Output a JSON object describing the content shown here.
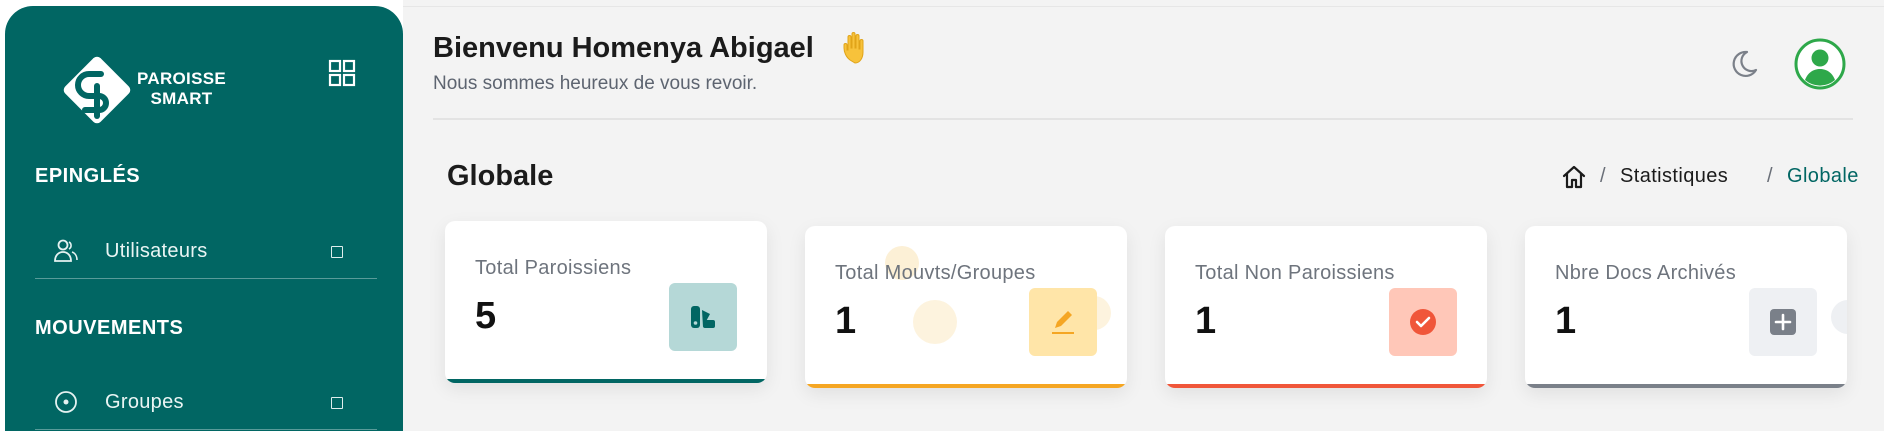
{
  "brand": {
    "line1": "PAROISSE",
    "line2": "SMART"
  },
  "sidebar": {
    "sections": [
      {
        "title": "EPINGLÉS",
        "items": [
          {
            "label": "Utilisateurs",
            "icon": "users-icon"
          }
        ]
      },
      {
        "title": "MOUVEMENTS",
        "items": [
          {
            "label": "Groupes",
            "icon": "circle-dot-icon"
          }
        ]
      }
    ]
  },
  "header": {
    "greeting": "Bienvenu Homenya Abigael",
    "subtitle": "Nous sommes heureux de vous revoir."
  },
  "page": {
    "title": "Globale",
    "breadcrumb": {
      "sep": "/",
      "item": "Statistiques",
      "current": "Globale"
    }
  },
  "cards": [
    {
      "label": "Total Paroissiens",
      "value": "5",
      "icon": "swatches-icon",
      "accent": "#016663",
      "icon_bg": "#b5d8d7"
    },
    {
      "label": "Total Mouvts/Groupes",
      "value": "1",
      "icon": "pencil-icon",
      "accent": "#f5a623",
      "icon_bg": "#ffe5a8"
    },
    {
      "label": "Total Non Paroissiens",
      "value": "1",
      "icon": "check-circle-icon",
      "accent": "#f0563a",
      "icon_bg": "#ffc7b8"
    },
    {
      "label": "Nbre Docs Archivés",
      "value": "1",
      "icon": "plus-square-icon",
      "accent": "#7a8089",
      "icon_bg": "#eef0f3"
    }
  ],
  "colors": {
    "brand": "#016663",
    "background": "#f3f3f3",
    "avatar": "#2ea84a"
  }
}
